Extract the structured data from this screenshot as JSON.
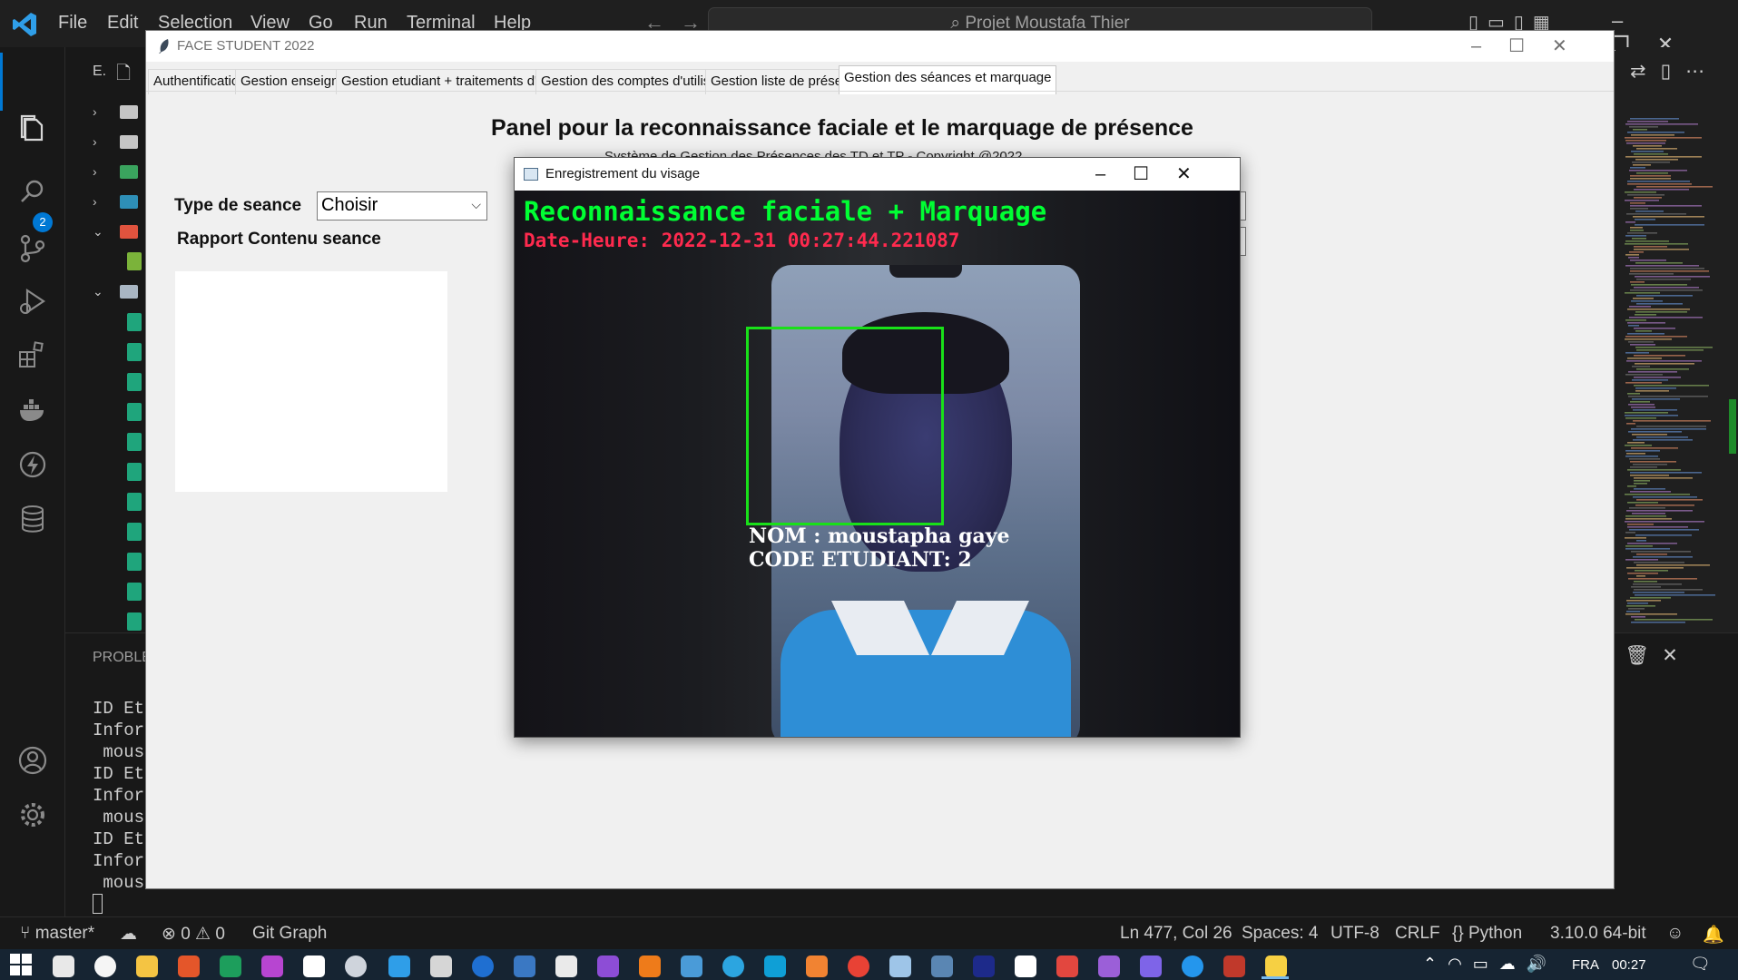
{
  "vscode": {
    "menu": [
      "File",
      "Edit",
      "Selection",
      "View",
      "Go",
      "Run",
      "Terminal",
      "Help"
    ],
    "command_center": "Projet Moustafa Thier",
    "explorer_label": "E.",
    "scm_badge": "2",
    "panel_tab": "PROBLE",
    "terminal_lines": [
      "ID Et",
      "Infor",
      " mous",
      "ID Et",
      "Infor",
      " mous",
      "ID Et",
      "Infor",
      " mous"
    ]
  },
  "status_bar": {
    "branch": "master*",
    "problems": "⊗ 0 ⚠ 0",
    "git_graph": "Git Graph",
    "position": "Ln 477, Col 26",
    "spaces": "Spaces: 4",
    "encoding": "UTF-8",
    "eol": "CRLF",
    "language": "Python",
    "interpreter": "3.10.0 64-bit"
  },
  "taskbar": {
    "lang": "FRA",
    "time": "00:27"
  },
  "app": {
    "title": "FACE STUDENT 2022",
    "tabs": [
      "Authentification",
      "Gestion enseignant",
      "Gestion etudiant + traitements d'image",
      "Gestion des comptes d'utilisateur",
      "Gestion liste de présences",
      "Gestion des séances et marquage"
    ],
    "active_tab_index": 5,
    "panel_title": "Panel pour la reconnaissance faciale et le marquage de présence",
    "panel_subtitle": "Système de Gestion des Présences des TD et TP - Copyright @2022",
    "type_label": "Type de seance",
    "type_value": "Choisir",
    "rapport_label": "Rapport Contenu seance"
  },
  "face_window": {
    "title": "Enregistrement du visage",
    "overlay_title": "Reconnaissance faciale + Marquage",
    "overlay_datetime": "Date-Heure: 2022-12-31 00:27:44.221087",
    "overlay_name": "NOM : moustapha gaye",
    "overlay_code": "CODE ETUDIANT: 2",
    "box_color": "#19e019",
    "title_color": "#00ff33",
    "datetime_color": "#ff2a4e"
  },
  "colors": {
    "vscode_accent": "#0078d4",
    "vscode_bg": "#1f1f1f",
    "taskbar_bg": "#162432"
  }
}
